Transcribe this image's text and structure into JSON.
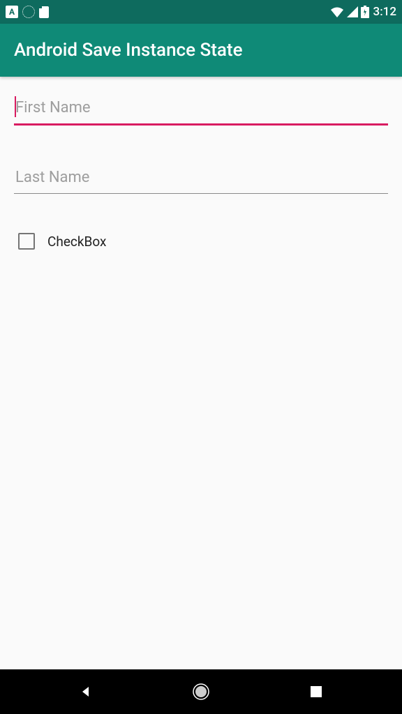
{
  "status": {
    "time": "3:12"
  },
  "appbar": {
    "title": "Android Save Instance State"
  },
  "form": {
    "firstName": {
      "placeholder": "First Name",
      "value": ""
    },
    "lastName": {
      "placeholder": "Last Name",
      "value": ""
    },
    "checkbox": {
      "label": "CheckBox",
      "checked": false
    }
  }
}
